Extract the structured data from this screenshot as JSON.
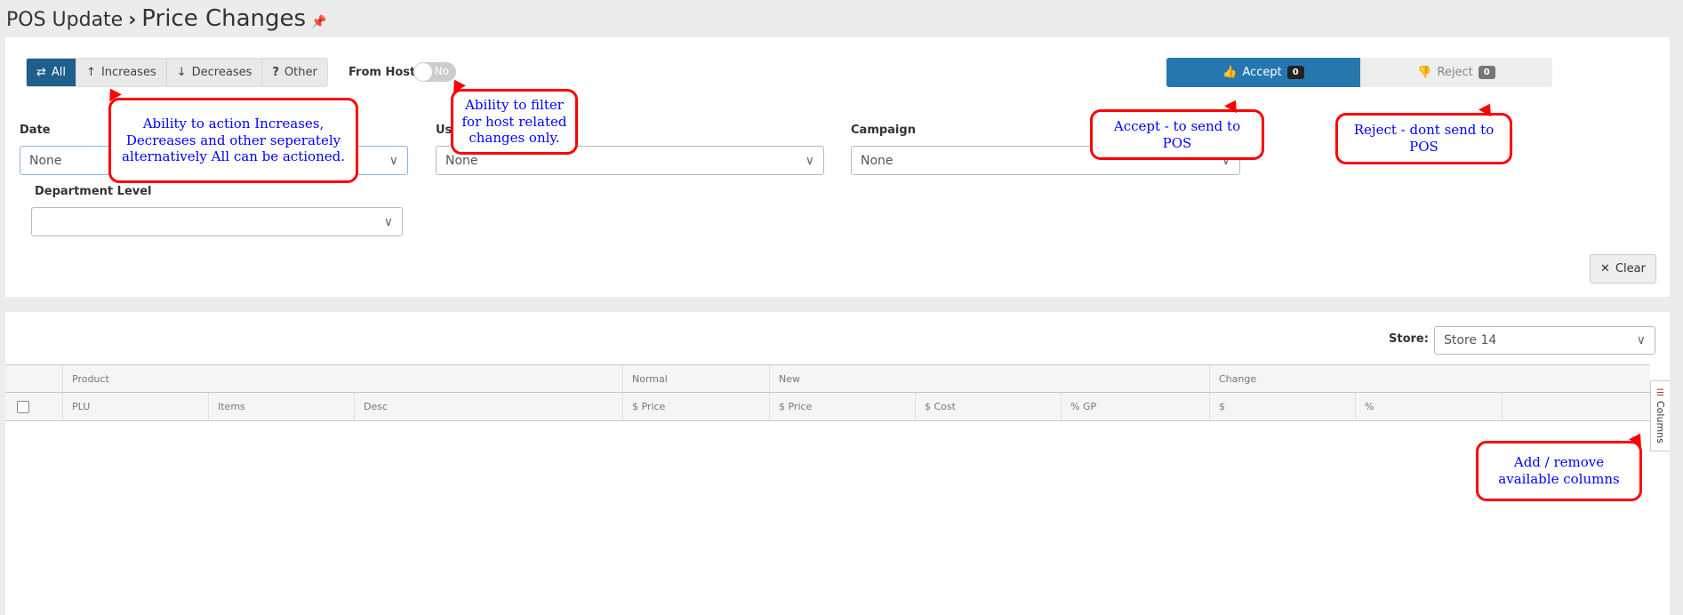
{
  "header": {
    "breadcrumb_parent": "POS Update",
    "separator": "›",
    "title": "Price Changes"
  },
  "filters": {
    "type_buttons": [
      {
        "icon": "⇄",
        "label": "All",
        "active": true
      },
      {
        "icon": "↑",
        "label": "Increases"
      },
      {
        "icon": "↓",
        "label": "Decreases"
      },
      {
        "icon": "?",
        "label": "Other"
      }
    ],
    "from_host_label": "From Host",
    "from_host_value": "No",
    "date_label": "Date",
    "date_value": "None",
    "user_label": "User",
    "user_value": "None",
    "campaign_label": "Campaign",
    "campaign_value": "None",
    "department_label": "Department Level",
    "department_value": "",
    "clear_label": "Clear"
  },
  "actions": {
    "accept_label": "Accept",
    "accept_count": "0",
    "reject_label": "Reject",
    "reject_count": "0",
    "accept_color": "#2577ad"
  },
  "table": {
    "store_label": "Store:",
    "store_value": "Store 14",
    "group_headers": [
      "Product",
      "Normal",
      "New",
      "Change"
    ],
    "columns": [
      "PLU",
      "Items",
      "Desc",
      "$ Price",
      "$ Price",
      "$ Cost",
      "% GP",
      "$",
      "%"
    ],
    "columns_panel_label": "Columns"
  },
  "annotations": [
    "Ability to action Increases, Decreases and other seperately alternatively All can be actioned.",
    "Ability to filter for host related changes only.",
    "Accept - to send to POS",
    "Reject - dont send to POS",
    "Add / remove available columns"
  ]
}
